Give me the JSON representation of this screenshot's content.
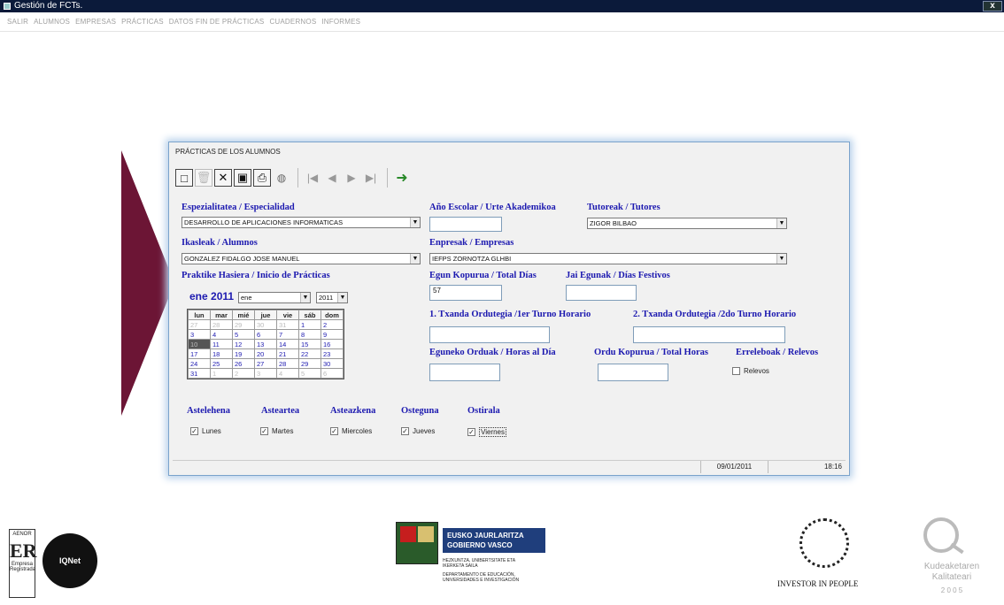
{
  "app": {
    "title": "Gestión de FCTs.",
    "close": "x"
  },
  "menu": [
    "SALIR",
    "ALUMNOS",
    "EMPRESAS",
    "PRÁCTICAS",
    "DATOS FIN DE PRÁCTICAS",
    "CUADERNOS",
    "INFORMES"
  ],
  "form": {
    "title": "PRÁCTICAS DE LOS ALUMNOS",
    "toolbar": {
      "icons": [
        "new-doc-icon",
        "delete-icon",
        "cancel-x-icon",
        "save-disk-icon",
        "print-icon",
        "find-binoculars-icon",
        "first-record-icon",
        "prev-record-icon",
        "next-record-icon",
        "last-record-icon",
        "exit-door-icon"
      ]
    },
    "especialidad": {
      "label": "Espezialitatea / Especialidad",
      "value": "DESARROLLO DE APLICACIONES INFORMATICAS"
    },
    "anio": {
      "label": "Año Escolar / Urte Akademikoa",
      "value": ""
    },
    "tutores": {
      "label": "Tutoreak / Tutores",
      "value": "ZIGOR BILBAO"
    },
    "alumnos": {
      "label": "Ikasleak / Alumnos",
      "value": "GONZALEZ FIDALGO JOSE MANUEL"
    },
    "empresas": {
      "label": "Enpresak / Empresas",
      "value": "IEFPS ZORNOTZA GLHBI"
    },
    "inicio": {
      "label": "Praktike Hasiera / Inicio de Prácticas"
    },
    "total_dias": {
      "label": "Egun Kopurua / Total Días",
      "value": "57"
    },
    "festivos": {
      "label": "Jai Egunak / Días Festivos",
      "value": ""
    },
    "turno1": {
      "label": "1. Txanda Ordutegia /1er Turno Horario",
      "value": ""
    },
    "turno2": {
      "label": "2. Txanda Ordutegia /2do Turno Horario",
      "value": ""
    },
    "horas_dia": {
      "label": "Eguneko Orduak / Horas al Día",
      "value": ""
    },
    "total_horas": {
      "label": "Ordu Kopurua / Total Horas",
      "value": ""
    },
    "relevos": {
      "label": "Erreleboak / Relevos",
      "check_label": "Relevos",
      "checked": false
    },
    "calendar": {
      "header_month": "ene",
      "header_year": "2011",
      "month_select": "ene",
      "year_select": "2011",
      "weekdays": [
        "lun",
        "mar",
        "mié",
        "jue",
        "vie",
        "sáb",
        "dom"
      ],
      "weeks": [
        [
          "27",
          "28",
          "29",
          "30",
          "31",
          "1",
          "2"
        ],
        [
          "3",
          "4",
          "5",
          "6",
          "7",
          "8",
          "9"
        ],
        [
          "10",
          "11",
          "12",
          "13",
          "14",
          "15",
          "16"
        ],
        [
          "17",
          "18",
          "19",
          "20",
          "21",
          "22",
          "23"
        ],
        [
          "24",
          "25",
          "26",
          "27",
          "28",
          "29",
          "30"
        ],
        [
          "31",
          "1",
          "2",
          "3",
          "4",
          "5",
          "6"
        ]
      ]
    },
    "days": [
      {
        "heading": "Astelehena",
        "check": "Lunes",
        "checked": true
      },
      {
        "heading": "Asteartea",
        "check": "Martes",
        "checked": true
      },
      {
        "heading": "Asteazkena",
        "check": "Miercoles",
        "checked": true
      },
      {
        "heading": "Osteguna",
        "check": "Jueves",
        "checked": true
      },
      {
        "heading": "Ostirala",
        "check": "Viernes",
        "checked": true
      }
    ],
    "status": {
      "date": "09/01/2011",
      "time": "18:16"
    }
  },
  "logos": {
    "aenor": {
      "top": "AENOR",
      "mark": "ER",
      "sub": "Empresa Registrada"
    },
    "iqnet": "IQNet",
    "ej": {
      "line1": "EUSKO JAURLARITZA",
      "line2": "GOBIERNO VASCO",
      "dept1": "HEZKUNTZA, UNIBERTSITATE ETA IKERKETA SAILA",
      "dept2": "DEPARTAMENTO DE EDUCACIÓN, UNIVERSIDADES E INVESTIGACIÓN"
    },
    "iip": "INVESTOR IN PEOPLE",
    "kq": {
      "line1": "Kudeaketaren",
      "line2": "Kalitateari",
      "line3": "2 0 0 5"
    }
  }
}
